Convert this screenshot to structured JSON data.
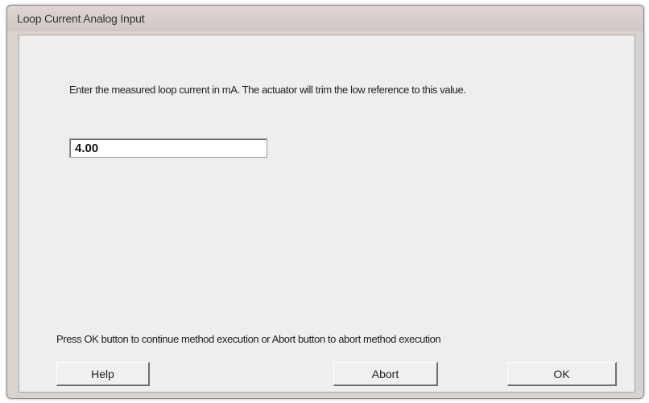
{
  "window": {
    "title": "Loop Current Analog Input"
  },
  "prompt": {
    "text": "Enter the measured loop current in mA. The actuator will trim the low reference to this value."
  },
  "input": {
    "value": "4.00"
  },
  "footer": {
    "text": "Press OK button to continue method execution or Abort button to abort method execution"
  },
  "buttons": {
    "help": "Help",
    "abort": "Abort",
    "ok": "OK"
  }
}
